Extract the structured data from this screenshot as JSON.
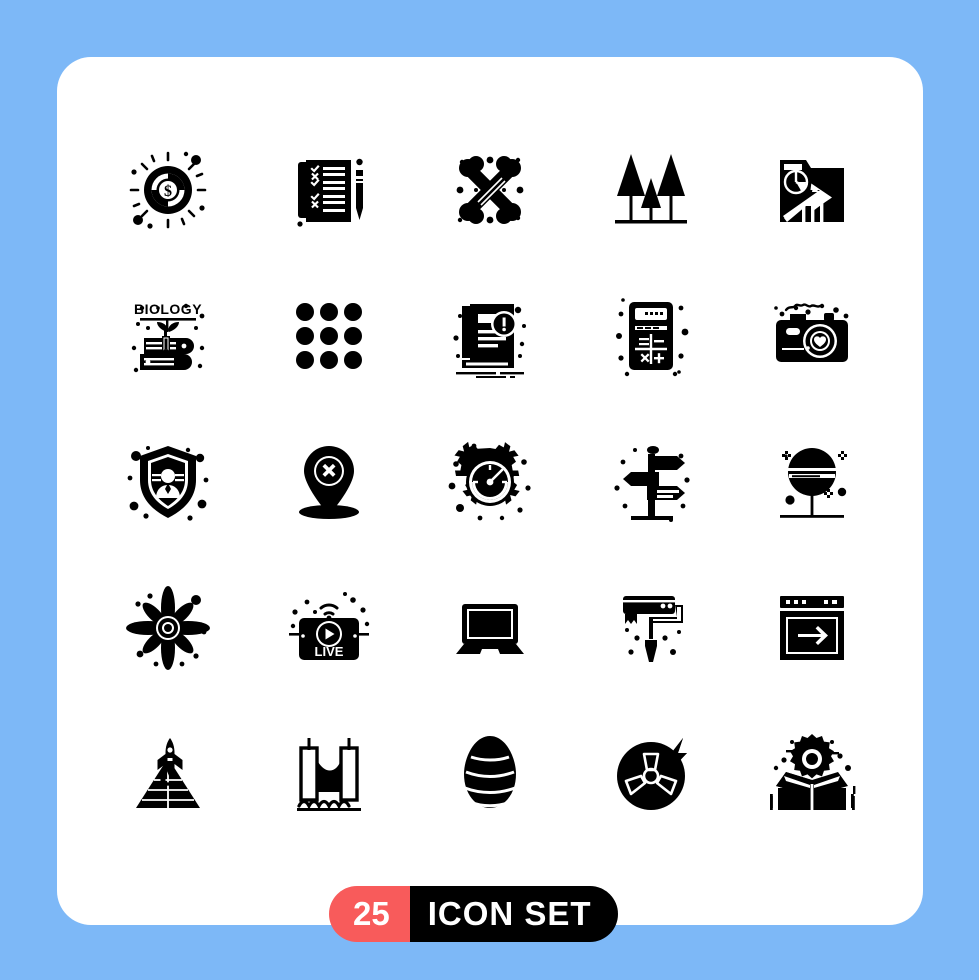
{
  "page": {
    "background_color": "#7db8f7",
    "card_color": "#ffffff",
    "icon_color": "#000000"
  },
  "badge": {
    "count": "25",
    "title": "ICON SET",
    "count_bg": "#f85b5b",
    "title_bg": "#000000",
    "text_color": "#ffffff"
  },
  "icon_set": {
    "total": 25,
    "columns": 5,
    "rows": 5,
    "icons": [
      {
        "index": 1,
        "name": "dollar-target-icon",
        "label": "Money Target"
      },
      {
        "index": 2,
        "name": "checklist-pencil-icon",
        "label": "Checklist"
      },
      {
        "index": 3,
        "name": "crossed-bones-icon",
        "label": "Bones"
      },
      {
        "index": 4,
        "name": "forest-trees-icon",
        "label": "Forest"
      },
      {
        "index": 5,
        "name": "analytics-folder-icon",
        "label": "Business Folder"
      },
      {
        "index": 6,
        "name": "biology-book-icon",
        "label": "Biology"
      },
      {
        "index": 7,
        "name": "dot-grid-icon",
        "label": "Grid Menu"
      },
      {
        "index": 8,
        "name": "book-alert-icon",
        "label": "Book Alert"
      },
      {
        "index": 9,
        "name": "calculator-icon",
        "label": "Calculator"
      },
      {
        "index": 10,
        "name": "camera-heart-icon",
        "label": "Love Camera"
      },
      {
        "index": 11,
        "name": "shield-user-icon",
        "label": "Identity Shield"
      },
      {
        "index": 12,
        "name": "map-pin-cancel-icon",
        "label": "Cancel Location"
      },
      {
        "index": 13,
        "name": "gear-timer-icon",
        "label": "Performance"
      },
      {
        "index": 14,
        "name": "signpost-icon",
        "label": "Direction Sign"
      },
      {
        "index": 15,
        "name": "lollipop-icon",
        "label": "Lollipop"
      },
      {
        "index": 16,
        "name": "flower-icon",
        "label": "Flower"
      },
      {
        "index": 17,
        "name": "live-stream-icon",
        "label": "Live Stream"
      },
      {
        "index": 18,
        "name": "laptop-icon",
        "label": "Laptop"
      },
      {
        "index": 19,
        "name": "paint-roller-icon",
        "label": "Paint Roller"
      },
      {
        "index": 20,
        "name": "browser-arrow-icon",
        "label": "Browser Forward"
      },
      {
        "index": 21,
        "name": "rocket-pyramid-icon",
        "label": "Launch Pyramid"
      },
      {
        "index": 22,
        "name": "bridge-icon",
        "label": "Bridge"
      },
      {
        "index": 23,
        "name": "easter-egg-icon",
        "label": "Easter Egg"
      },
      {
        "index": 24,
        "name": "nuclear-energy-icon",
        "label": "Nuclear Energy"
      },
      {
        "index": 25,
        "name": "box-gear-icon",
        "label": "Product Setup"
      }
    ]
  }
}
